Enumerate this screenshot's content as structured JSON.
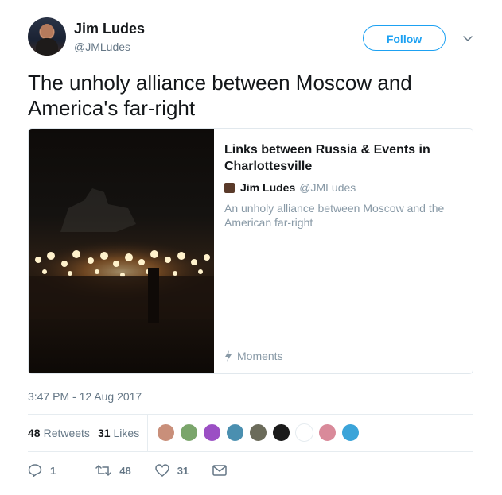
{
  "author": {
    "name": "Jim Ludes",
    "handle": "@JMLudes"
  },
  "follow_label": "Follow",
  "tweet_text": "The unholy alliance between Moscow and America's far-right",
  "card": {
    "title": "Links between Russia & Events in Charlottesville",
    "author_name": "Jim Ludes",
    "author_handle": "@JMLudes",
    "description": "An unholy alliance between Moscow and the American far-right",
    "footer_label": "Moments"
  },
  "timestamp": "3:47 PM - 12 Aug 2017",
  "stats": {
    "retweets_count": "48",
    "retweets_label": "Retweets",
    "likes_count": "31",
    "likes_label": "Likes"
  },
  "likers_colors": [
    "#c98f7a",
    "#7aa56b",
    "#9b4fc4",
    "#4a8fb0",
    "#6b6b5a",
    "#1a1a1a",
    "#ffffff",
    "#d98a9a",
    "#3ba4d9"
  ],
  "actions": {
    "reply_count": "1",
    "retweet_count": "48",
    "like_count": "31"
  },
  "colors": {
    "accent": "#1da1f2",
    "text": "#14171a",
    "muted": "#657786"
  }
}
